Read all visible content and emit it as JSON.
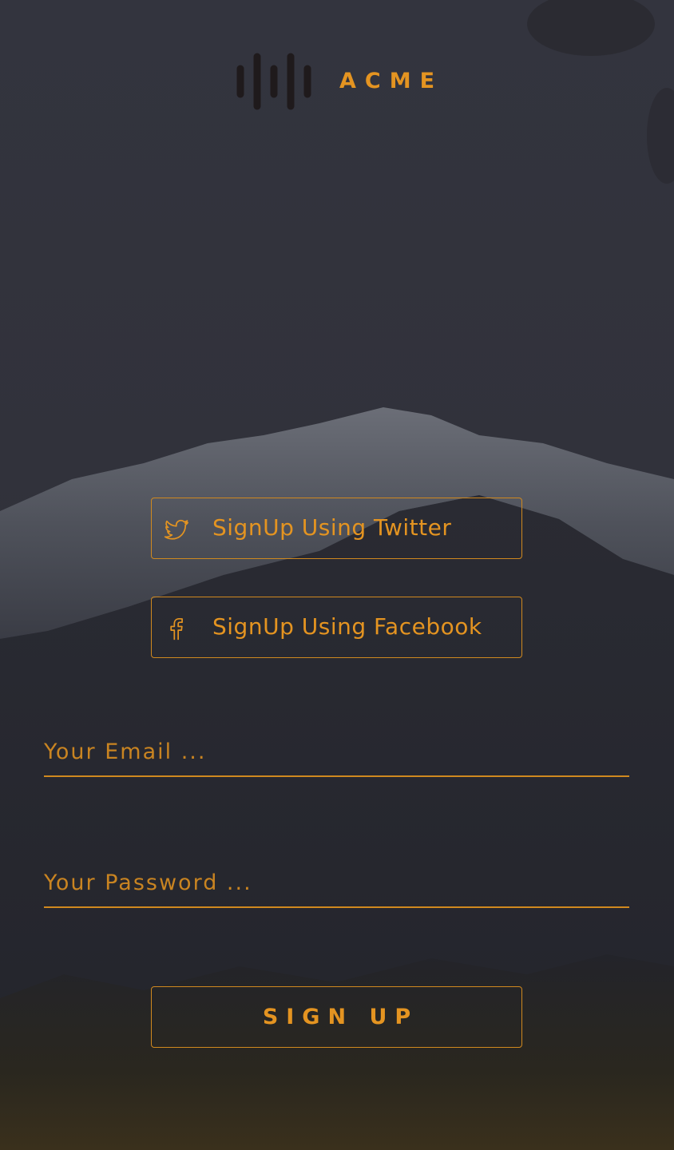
{
  "brand": {
    "name": "ACME",
    "accent_color": "#e49421",
    "logo_icon": "sound-bars-icon"
  },
  "social": {
    "twitter": {
      "label": "SignUp Using Twitter",
      "icon": "twitter-bird-icon"
    },
    "facebook": {
      "label": "SignUp Using Facebook",
      "icon": "facebook-f-icon"
    }
  },
  "form": {
    "email": {
      "placeholder": "Your Email ...",
      "value": ""
    },
    "password": {
      "placeholder": "Your Password ...",
      "value": ""
    },
    "submit_label": "SIGN UP"
  },
  "background": {
    "scene": "snow-capped mountain with forest",
    "base_color": "#2f3039"
  }
}
